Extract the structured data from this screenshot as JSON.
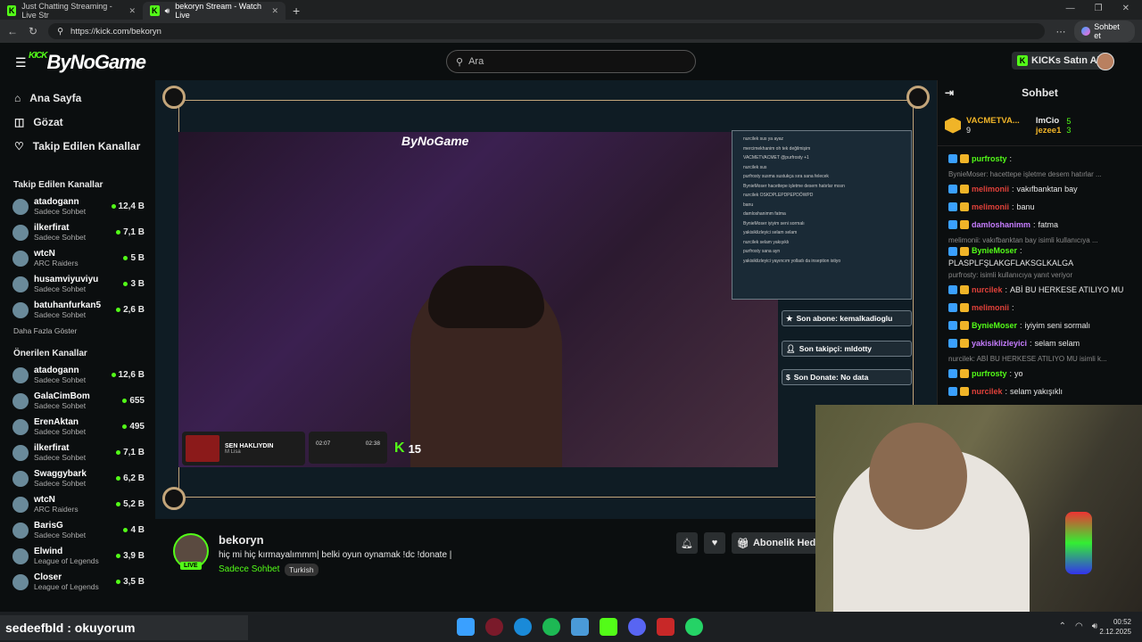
{
  "browser": {
    "tabs": [
      {
        "label": "Just Chatting Streaming - Live Str"
      },
      {
        "label": "bekoryn Stream - Watch Live"
      }
    ],
    "url": "https://kick.com/bekoryn",
    "chat_button": "Sohbet et"
  },
  "header": {
    "logo": "ByNoGame",
    "logo_prefix": "KICK",
    "search_placeholder": "Ara",
    "buy_kicks": "KICKs Satın Al"
  },
  "sidebar": {
    "nav": [
      {
        "label": "Ana Sayfa",
        "icon": "home-icon"
      },
      {
        "label": "Gözat",
        "icon": "browse-icon"
      },
      {
        "label": "Takip Edilen Kanallar",
        "icon": "heart-icon"
      }
    ],
    "followed_title": "Takip Edilen Kanallar",
    "followed": [
      {
        "name": "atadogann",
        "category": "Sadece Sohbet",
        "viewers": "12,4 B"
      },
      {
        "name": "ilkerfirat",
        "category": "Sadece Sohbet",
        "viewers": "7,1 B"
      },
      {
        "name": "wtcN",
        "category": "ARC Raiders",
        "viewers": "5 B"
      },
      {
        "name": "husamviyuviyu",
        "category": "Sadece Sohbet",
        "viewers": "3 B"
      },
      {
        "name": "batuhanfurkan5",
        "category": "Sadece Sohbet",
        "viewers": "2,6 B"
      }
    ],
    "show_more": "Daha Fazla Göster",
    "recommended_title": "Önerilen Kanallar",
    "recommended": [
      {
        "name": "atadogann",
        "category": "Sadece Sohbet",
        "viewers": "12,6 B"
      },
      {
        "name": "GalaCimBom",
        "category": "Sadece Sohbet",
        "viewers": "655"
      },
      {
        "name": "ErenAktan",
        "category": "Sadece Sohbet",
        "viewers": "495"
      },
      {
        "name": "ilkerfirat",
        "category": "Sadece Sohbet",
        "viewers": "7,1 B"
      },
      {
        "name": "Swaggybark",
        "category": "Sadece Sohbet",
        "viewers": "6,2 B"
      },
      {
        "name": "wtcN",
        "category": "ARC Raiders",
        "viewers": "5,2 B"
      },
      {
        "name": "BarisG",
        "category": "Sadece Sohbet",
        "viewers": "4 B"
      },
      {
        "name": "Elwind",
        "category": "League of Legends",
        "viewers": "3,9 B"
      },
      {
        "name": "Closer",
        "category": "League of Legends",
        "viewers": "3,5 B"
      }
    ]
  },
  "stream": {
    "overlay_logo": "ByNoGame",
    "overlay_chat": [
      "nurcilek sus ya ayaz",
      "mercimekhanim oh tek değilmişim",
      "VACMETVACMET @purfrosty +1",
      "nurcilek sus",
      "purfrosty susma sustukça sıra sana felecek",
      "BynieMoser hacettepe işletme desem hatırlar mısın",
      "nurcilek OSKDPLEPDPEPDÖWPD",
      "banu",
      "damloshanimm fatma",
      "BynieMoser iyiyim seni sormalı",
      "yakisiklizleyici selam selam",
      "nurcilek selam yakışıklı",
      "purfrosty sana ayn",
      "yakisiklizleyici yayıncım yolladı da inseption istiyo"
    ],
    "last_sub": "Son abone: kemalkadioglu",
    "last_follower": "Son takipçi: mldotty",
    "last_donate": "Son Donate: No data",
    "now_playing_title": "SEN HAKLIYDIN",
    "now_playing_artist": "M Lisa",
    "time_elapsed": "02:07",
    "time_total": "02:38",
    "kick_count": "15"
  },
  "channel": {
    "name": "bekoryn",
    "live_badge": "LIVE",
    "title": "hiç mi hiç kırmayalımmm| belki oyun oynamak !dc !donate |",
    "category": "Sadece Sohbet",
    "language": "Turkish",
    "subscribe": "Abonelik Hedi"
  },
  "chat": {
    "title": "Sohbet",
    "gifters": [
      {
        "name": "VACMETVA...",
        "count": "9"
      },
      {
        "name": "lmCio",
        "count": "5"
      },
      {
        "name": "jezee1",
        "count": "3"
      }
    ],
    "messages": [
      {
        "type": "msg",
        "user": "purfrosty",
        "color": "#53fc18",
        "text": ""
      },
      {
        "type": "reply",
        "text": "BynieMoser: hacettepe işletme desem hatırlar ..."
      },
      {
        "type": "msg",
        "user": "melimonii",
        "color": "#e0413a",
        "text": "vakıfbanktan bay"
      },
      {
        "type": "msg",
        "user": "melimonii",
        "color": "#e0413a",
        "text": "banu"
      },
      {
        "type": "msg",
        "user": "damloshanimm",
        "color": "#c77dff",
        "text": "fatma"
      },
      {
        "type": "reply",
        "text": "melimonii: vakıfbanktan bay isimli kullanıcıya ..."
      },
      {
        "type": "msg",
        "user": "BynieMoser",
        "color": "#53fc18",
        "text": "PLASPLFŞLAKGFLAKSGLKALGA"
      },
      {
        "type": "reply",
        "text": "purfrosty: isimli kullanıcıya yanıt veriyor"
      },
      {
        "type": "msg",
        "user": "nurcilek",
        "color": "#e0413a",
        "text": "ABİ BU HERKESE ATILIYO MU"
      },
      {
        "type": "msg",
        "user": "melimonii",
        "color": "#e0413a",
        "text": ""
      },
      {
        "type": "msg",
        "user": "BynieMoser",
        "color": "#53fc18",
        "text": "iyiyim seni sormalı"
      },
      {
        "type": "msg",
        "user": "yakisiklizleyici",
        "color": "#c77dff",
        "text": "selam selam"
      },
      {
        "type": "reply",
        "text": "nurcilek: ABİ BU HERKESE ATILIYO MU isimli k..."
      },
      {
        "type": "msg",
        "user": "purfrosty",
        "color": "#53fc18",
        "text": "yo"
      },
      {
        "type": "msg",
        "user": "nurcilek",
        "color": "#e0413a",
        "text": "selam yakışıklı"
      }
    ]
  },
  "taskbar": {
    "banner": "sedeefbld : okuyorum",
    "time": "00:52",
    "date": "2.12.2025"
  }
}
